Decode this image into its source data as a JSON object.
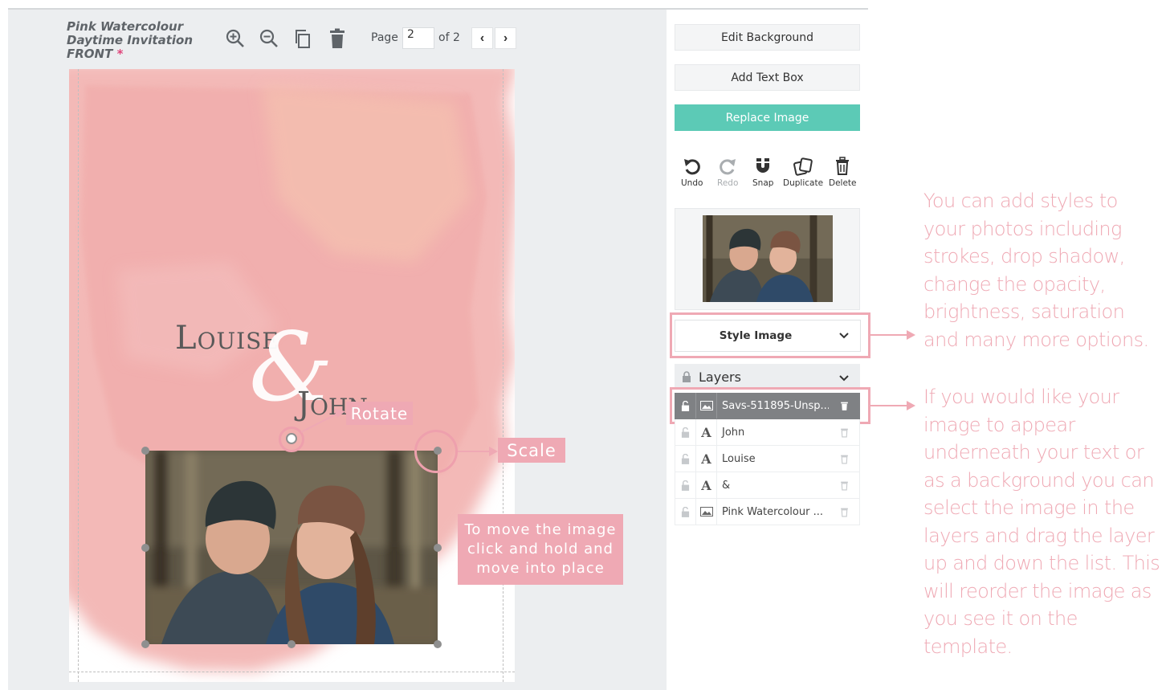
{
  "document": {
    "title_line1": "Pink Watercolour",
    "title_line2": "Daytime Invitation",
    "title_line3": "FRONT",
    "unsaved_marker": "*"
  },
  "toolbar": {
    "page_label": "Page",
    "page_value": "2",
    "page_total": "of 2",
    "prev_glyph": "‹",
    "next_glyph": "›",
    "icons": [
      "zoom-in-icon",
      "zoom-out-icon",
      "copy-page-icon",
      "delete-page-icon"
    ]
  },
  "canvas": {
    "name1": "Louise",
    "ampersand": "&",
    "name2": "John"
  },
  "annotations": {
    "rotate": "Rotate",
    "scale": "Scale",
    "move": "To move the image click and hold and move into place",
    "explain_styles": "You can add styles to your photos including strokes, drop shadow, change the opacity, brightness, saturation and many more options.",
    "explain_layers": "If you would like your image to appear underneath your text or as a background you can select the image in the layers and drag the layer up and down the list. This will reorder the image as you see it on the template.",
    "accent_color": "#efa9b4"
  },
  "panel": {
    "edit_background": "Edit Background",
    "add_text_box": "Add Text Box",
    "replace_image": "Replace Image",
    "replace_color": "#5ccab6",
    "tools": {
      "undo": "Undo",
      "redo": "Redo",
      "snap": "Snap",
      "duplicate": "Duplicate",
      "delete": "Delete"
    },
    "style_image": "Style Image",
    "layers_title": "Layers",
    "layers": [
      {
        "name": "Savs-511895-Unsp...",
        "type": "image",
        "selected": true
      },
      {
        "name": "John",
        "type": "text",
        "selected": false
      },
      {
        "name": "Louise",
        "type": "text",
        "selected": false
      },
      {
        "name": "&",
        "type": "text",
        "selected": false
      },
      {
        "name": "Pink Watercolour ...",
        "type": "image",
        "selected": false
      }
    ]
  }
}
